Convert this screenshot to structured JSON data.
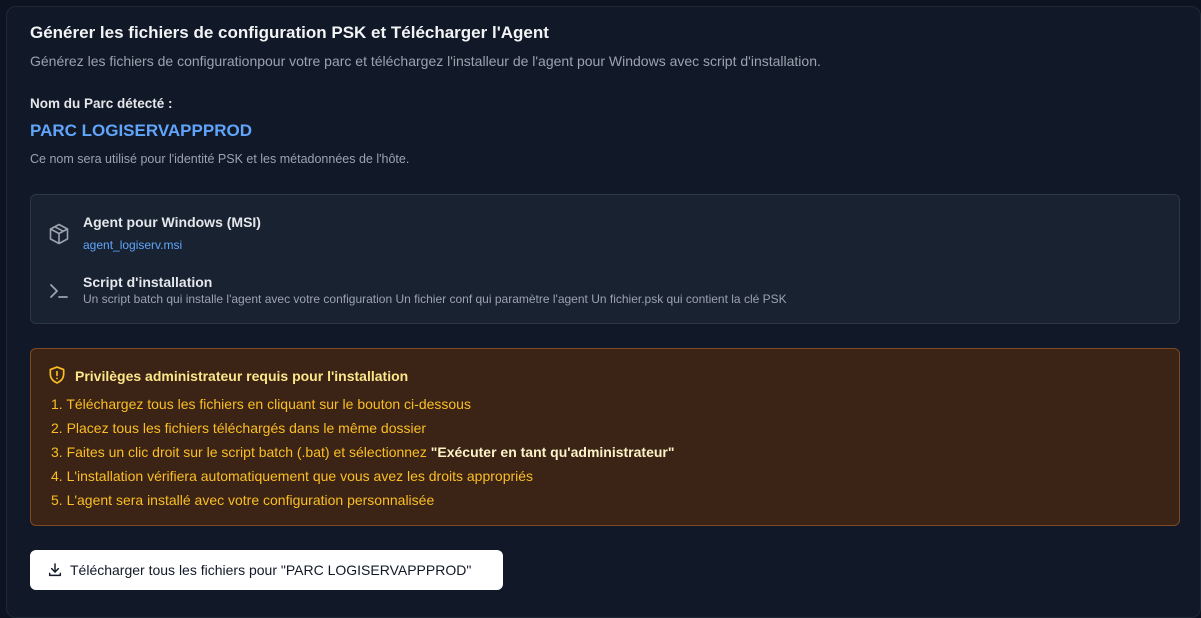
{
  "header": {
    "title": "Générer les fichiers de configuration PSK et Télécharger l'Agent",
    "subtitle": "Générez les fichiers de configurationpour votre parc et téléchargez l'installeur de l'agent pour Windows avec script d'installation."
  },
  "park": {
    "label": "Nom du Parc détecté :",
    "name": "PARC LOGISERVAPPPROD",
    "note": "Ce nom sera utilisé pour l'identité PSK et les métadonnées de l'hôte."
  },
  "files": [
    {
      "icon": "package-icon",
      "title": "Agent pour Windows (MSI)",
      "link": "agent_logiserv.msi"
    },
    {
      "icon": "terminal-icon",
      "title": "Script d'installation",
      "description": "Un script batch qui installe l'agent avec votre configuration Un fichier conf qui paramètre l'agent Un fichier.psk qui contient la clé PSK"
    }
  ],
  "warning": {
    "icon": "shield-alert-icon",
    "title": "Privilèges administrateur requis pour l'installation",
    "steps": [
      "1. Téléchargez tous les fichiers en cliquant sur le bouton ci-dessous",
      "2. Placez tous les fichiers téléchargés dans le même dossier",
      "3. Faites un clic droit sur le script batch (.bat) et sélectionnez ",
      "4. L'installation vérifiera automatiquement que vous avez les droits appropriés",
      "5. L'agent sera installé avec votre configuration personnalisée"
    ],
    "step3_emphasis": "\"Exécuter en tant qu'administrateur\""
  },
  "download_button": {
    "icon": "download-icon",
    "label": "Télécharger tous les fichiers pour \"PARC LOGISERVAPPPROD\""
  },
  "colors": {
    "accent": "#60a5fa",
    "warning_text": "#fbbf24",
    "warning_bg": "#3b2315",
    "card_bg": "#111827"
  }
}
